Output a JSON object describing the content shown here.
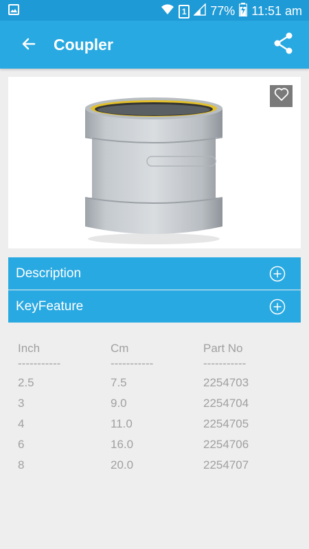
{
  "status_bar": {
    "battery": "77%",
    "time": "11:51 am",
    "sim_slot": "1",
    "icons": [
      "image-icon",
      "wifi-icon",
      "sim-icon",
      "signal-icon",
      "battery-charging-icon"
    ]
  },
  "app_bar": {
    "title": "Coupler",
    "back_icon": "arrow-back-icon",
    "share_icon": "share-icon"
  },
  "product": {
    "image_alt": "Coupler pipe fitting",
    "favorite_icon": "heart-outline-icon"
  },
  "sections": {
    "description_label": "Description",
    "keyfeature_label": "KeyFeature",
    "expand_icon": "plus-circle-icon"
  },
  "spec_table": {
    "headers": [
      "Inch",
      "Cm",
      "Part No"
    ],
    "separators": [
      "-----------",
      "-----------",
      "-----------"
    ],
    "rows": [
      [
        "2.5",
        "7.5",
        "2254703"
      ],
      [
        "3",
        "9.0",
        "2254704"
      ],
      [
        "4",
        "11.0",
        "2254705"
      ],
      [
        "6",
        "16.0",
        "2254706"
      ],
      [
        "8",
        "20.0",
        "2254707"
      ]
    ]
  },
  "colors": {
    "status_bar": "#1e9ad6",
    "primary": "#29a9e1",
    "background": "#eeeeee",
    "table_text": "#a0a0a0"
  }
}
